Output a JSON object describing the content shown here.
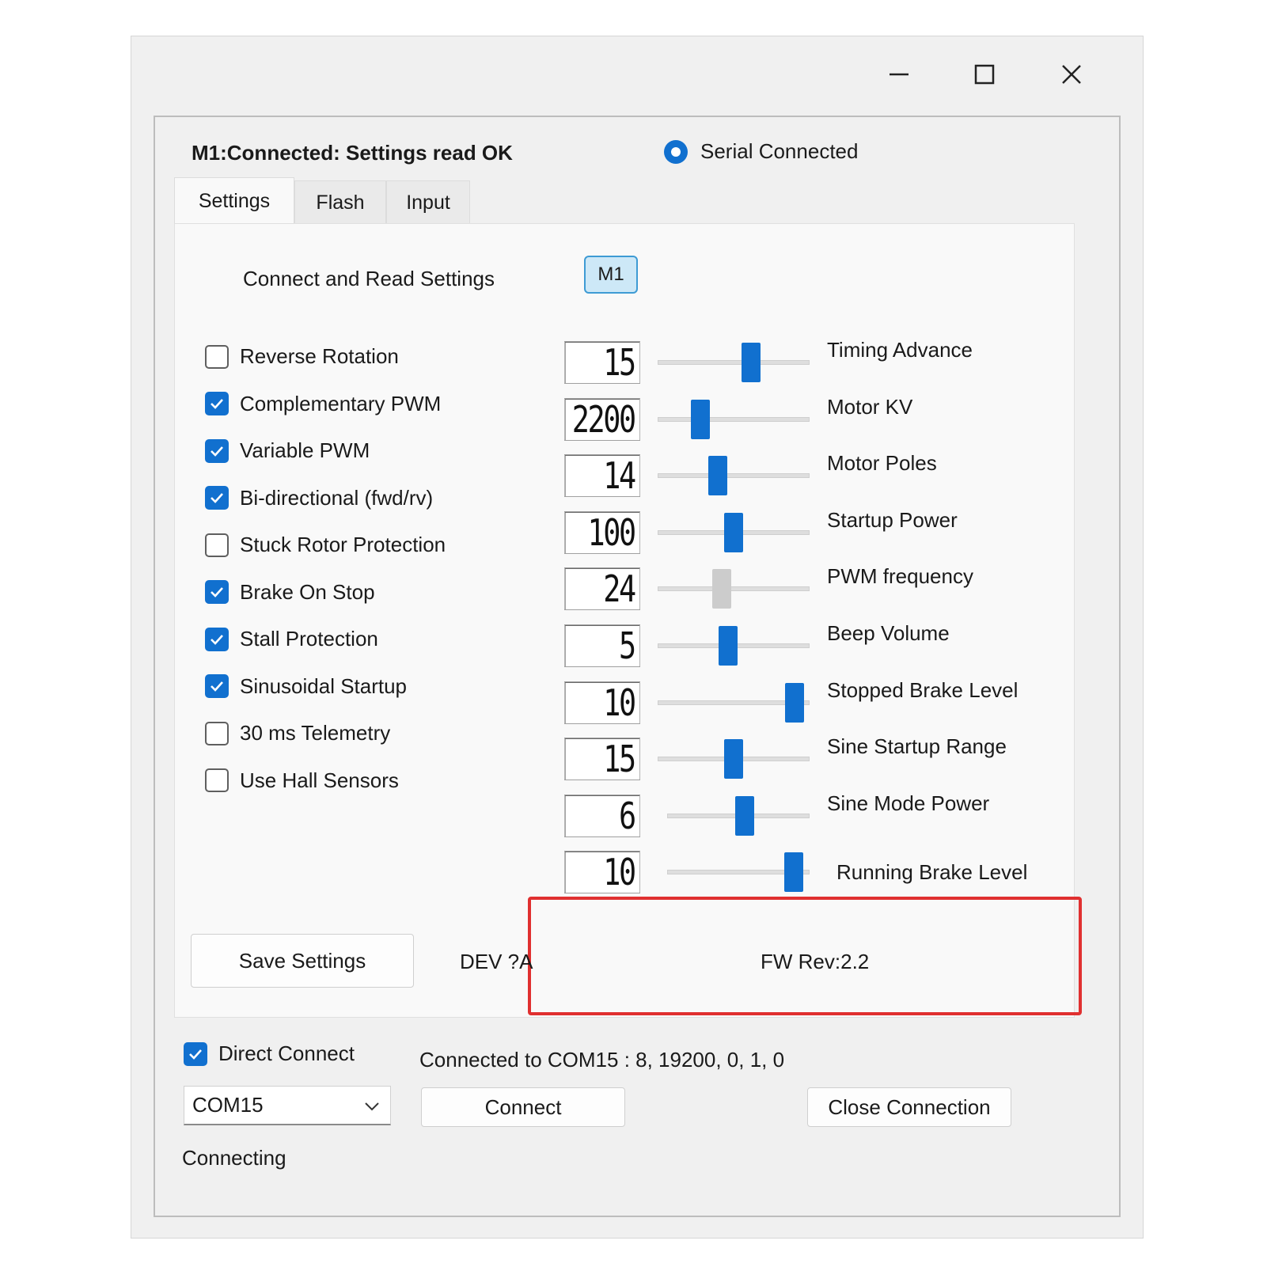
{
  "window": {
    "controls": [
      "minimize-icon",
      "maximize-icon",
      "close-icon"
    ]
  },
  "header": {
    "status_title": "M1:Connected: Settings read OK",
    "radio_label": "Serial Connected"
  },
  "tabs": [
    {
      "label": "Settings",
      "active": true
    },
    {
      "label": "Flash",
      "active": false
    },
    {
      "label": "Input",
      "active": false
    }
  ],
  "settings": {
    "connect_label": "Connect and Read Settings",
    "m1_button": "M1",
    "checkboxes": [
      {
        "label": "Reverse Rotation",
        "checked": false
      },
      {
        "label": "Complementary PWM",
        "checked": true
      },
      {
        "label": "Variable PWM",
        "checked": true
      },
      {
        "label": "Bi-directional (fwd/rv)",
        "checked": true
      },
      {
        "label": "Stuck Rotor Protection",
        "checked": false
      },
      {
        "label": "Brake On Stop",
        "checked": true
      },
      {
        "label": "Stall Protection",
        "checked": true
      },
      {
        "label": "Sinusoidal Startup",
        "checked": true
      },
      {
        "label": "30 ms Telemetry",
        "checked": false
      },
      {
        "label": "Use Hall Sensors",
        "checked": false
      }
    ],
    "sliders": [
      {
        "label": "Timing Advance",
        "value": "15",
        "level": 0.63,
        "enabled": true
      },
      {
        "label": "Motor KV",
        "value": "2200",
        "level": 0.25,
        "enabled": true
      },
      {
        "label": "Motor Poles",
        "value": "14",
        "level": 0.38,
        "enabled": true
      },
      {
        "label": "Startup Power",
        "value": "100",
        "level": 0.5,
        "enabled": true
      },
      {
        "label": "PWM frequency",
        "value": "24",
        "level": 0.41,
        "enabled": false
      },
      {
        "label": "Beep Volume",
        "value": "5",
        "level": 0.46,
        "enabled": true
      },
      {
        "label": "Stopped Brake Level",
        "value": "10",
        "level": 0.96,
        "enabled": true
      },
      {
        "label": "Sine Startup Range",
        "value": "15",
        "level": 0.5,
        "enabled": true
      },
      {
        "label": "Sine Mode Power",
        "value": "6",
        "level": 0.55,
        "enabled": true
      },
      {
        "label": "Running Brake Level",
        "value": "10",
        "level": 0.95,
        "enabled": true
      }
    ],
    "save_button": "Save Settings",
    "dev_label": "DEV ?A",
    "fw_label": "FW Rev:2.2"
  },
  "bottom": {
    "direct_connect_label": "Direct Connect",
    "direct_connect_checked": true,
    "connection_info": "Connected to COM15 : 8, 19200, 0, 1, 0",
    "port_value": "COM15",
    "connect_button": "Connect",
    "close_button": "Close Connection",
    "status": "Connecting"
  },
  "colors": {
    "accent": "#1170cf",
    "highlight": "#e03030"
  }
}
